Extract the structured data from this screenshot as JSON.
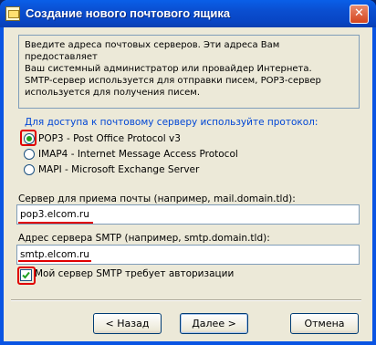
{
  "window": {
    "title": "Создание нового почтового ящика",
    "close_label": "✕"
  },
  "info": {
    "text": "Введите адреса почтовых серверов. Эти адреса Вам предоставляет\nВаш системный администратор или провайдер Интернета.\nSMTP-сервер используется для отправки писем, POP3-сервер\nиспользуется для получения писем."
  },
  "protocol": {
    "label": "Для доступа к почтовому серверу используйте протокол:",
    "options": [
      {
        "label": "POP3  -  Post Office Protocol v3",
        "selected": true
      },
      {
        "label": "IMAP4 - Internet Message Access Protocol",
        "selected": false
      },
      {
        "label": "MAPI - Microsoft Exchange Server",
        "selected": false
      }
    ]
  },
  "incoming": {
    "label": "Сервер для приема почты  (например, mail.domain.tld):",
    "value": "pop3.elcom.ru"
  },
  "outgoing": {
    "label": "Адрес сервера SMTP (например, smtp.domain.tld):",
    "value": "smtp.elcom.ru"
  },
  "auth_checkbox": {
    "label": "Мой сервер SMTP требует авторизации",
    "checked": true
  },
  "buttons": {
    "back": "< Назад",
    "next": "Далее >",
    "cancel": "Отмена"
  },
  "colors": {
    "titlebar": "#0a54e3",
    "annotation": "#e00000",
    "group_label": "#0046d5"
  }
}
